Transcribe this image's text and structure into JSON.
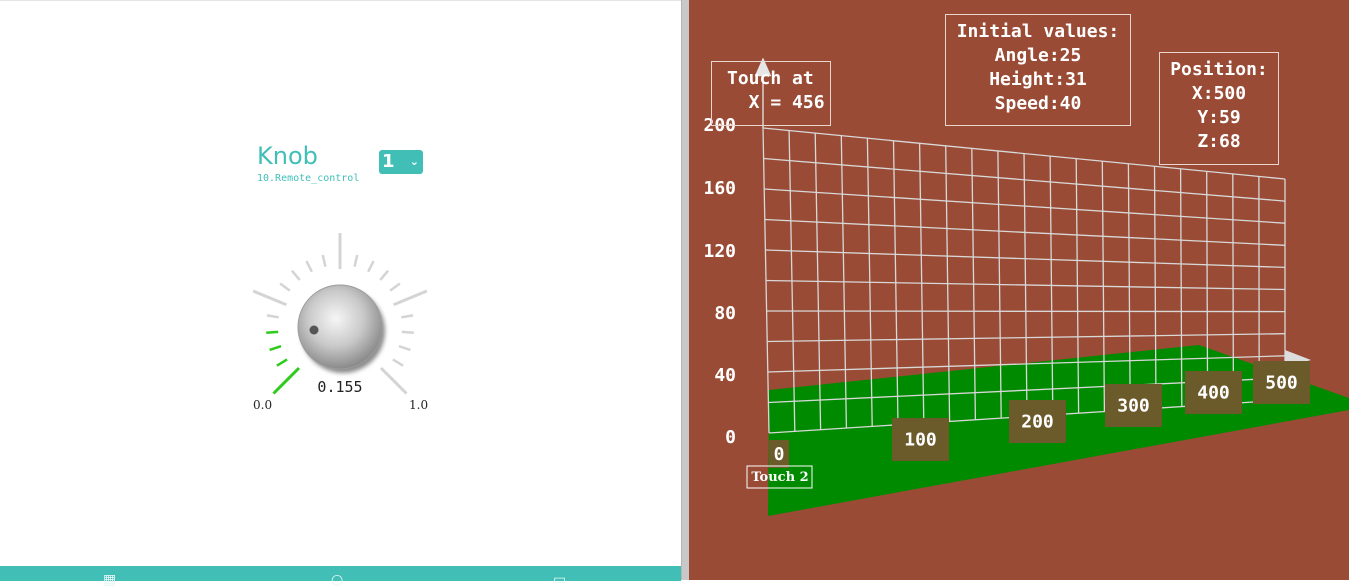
{
  "knob_panel": {
    "title": "Knob",
    "subtitle": "10.Remote_control",
    "channel_value": "1",
    "value": "0.155",
    "value_fraction": 0.155,
    "min_label": "0.0",
    "max_label": "1.0",
    "accent_color": "#41bfb7",
    "active_tick_color": "#2ecc1a",
    "bottom_nav_icons": [
      "grid-icon",
      "home-icon",
      "window-icon"
    ]
  },
  "scene_panel": {
    "background_color": "#994b35",
    "ground_color": "#008a00",
    "touch_box": {
      "line1": "Touch at",
      "line2": "  X = 456"
    },
    "initial_values": {
      "title": "Initial values:",
      "angle": "Angle:25",
      "height": "Height:31",
      "speed": "Speed:40"
    },
    "position": {
      "title": "Position:",
      "x": "X:500",
      "y": "Y:59",
      "z": "Z:68"
    },
    "touch2_label": "Touch 2"
  },
  "chart_data": {
    "type": "line",
    "title": "",
    "xlabel": "",
    "ylabel": "",
    "y_ticks": [
      "200",
      "160",
      "120",
      "80",
      "40",
      "0"
    ],
    "x_ticks": [
      "0",
      "100",
      "200",
      "300",
      "400",
      "500"
    ],
    "ylim": [
      0,
      200
    ],
    "xlim": [
      0,
      500
    ],
    "grid": true
  }
}
